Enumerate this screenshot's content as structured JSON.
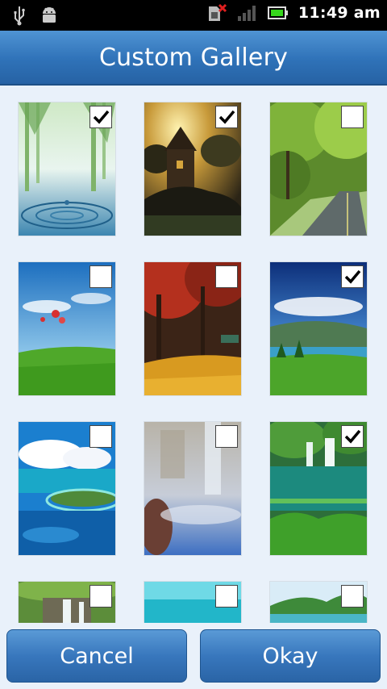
{
  "status_bar": {
    "time": "11:49 am",
    "icons": [
      "usb-icon",
      "android-debug-icon",
      "no-sim-icon",
      "signal-icon",
      "battery-icon"
    ]
  },
  "header": {
    "title": "Custom Gallery"
  },
  "gallery": {
    "items": [
      {
        "name": "water-drop-forest",
        "checked": true
      },
      {
        "name": "tower-house-sunset",
        "checked": true
      },
      {
        "name": "green-tree-road",
        "checked": false
      },
      {
        "name": "balloons-field",
        "checked": false
      },
      {
        "name": "autumn-forest",
        "checked": false
      },
      {
        "name": "mountain-lake-meadow",
        "checked": true
      },
      {
        "name": "tropical-island",
        "checked": false
      },
      {
        "name": "mist-waterfall",
        "checked": false
      },
      {
        "name": "jungle-waterfall-pool",
        "checked": true
      },
      {
        "name": "waterfall-cliff",
        "checked": false
      },
      {
        "name": "turquoise-sea",
        "checked": false
      },
      {
        "name": "green-hills-sea",
        "checked": false
      }
    ]
  },
  "buttons": {
    "cancel": "Cancel",
    "okay": "Okay"
  },
  "colors": {
    "title_bar": "#2f72b8",
    "background": "#e9f1fa",
    "button": "#3877bd"
  }
}
